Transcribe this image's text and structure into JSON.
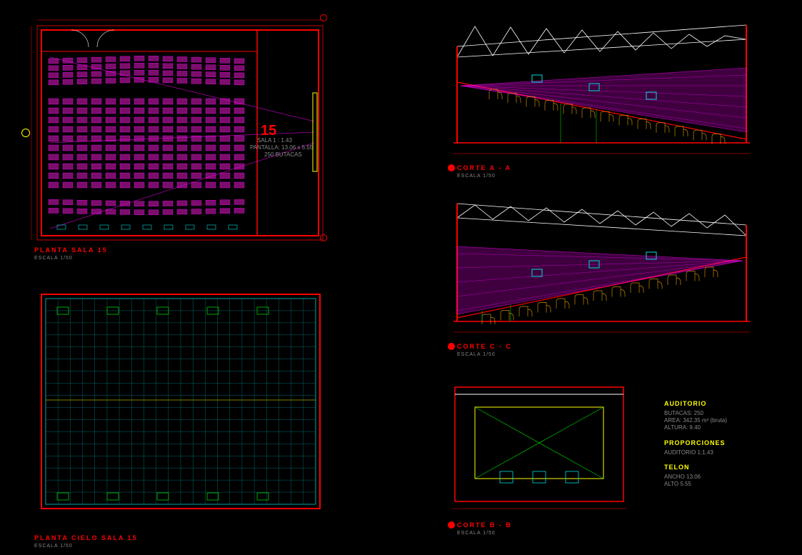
{
  "drawings": {
    "plan_sala": {
      "title": "PLANTA SALA 15",
      "scale": "ESCALA 1/50",
      "room_number": "15",
      "room_note1": "SALA    1 : 1.43",
      "room_note2": "PANTALLA: 13.06 x 5.55",
      "room_note3": "250 BUTACAS"
    },
    "plan_cielo": {
      "title": "PLANTA CIELO SALA 15",
      "scale": "ESCALA 1/50"
    },
    "corte_a": {
      "title": "CORTE A - A",
      "scale": "ESCALA 1/50"
    },
    "corte_c": {
      "title": "CORTE C - C",
      "scale": "ESCALA 1/50"
    },
    "corte_b": {
      "title": "CORTE B - B",
      "scale": "ESCALA 1/50"
    }
  },
  "info_block": {
    "header1": "AUDITORIO",
    "line1a": "BUTACAS: 250",
    "line1b": "AREA: 342.35 m² (bruta)",
    "line1c": "ALTURA: 9.40",
    "header2": "PROPORCIONES",
    "line2a": "AUDITORIO    1:1.43",
    "header3": "TELON",
    "line3a": "ANCHO 13.06",
    "line3b": "ALTO  5.55"
  },
  "colors": {
    "seat": "#a0158a",
    "seat_fill": "#7a0e6a",
    "wall": "#f00",
    "cyan": "#0dd",
    "grid": "#066",
    "yellow": "#ff0",
    "green": "#0c0",
    "blue": "#06f",
    "magenta": "#f0f",
    "amber": "#c80"
  }
}
